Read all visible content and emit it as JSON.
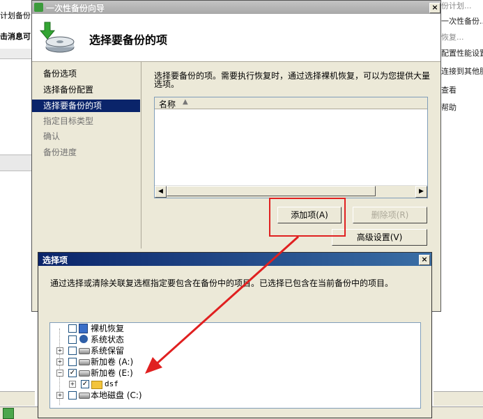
{
  "background": {
    "left_col": {
      "row1": "计划备份",
      "row2": "击消息可"
    },
    "right_actions": [
      "份计划...",
      "一次性备份...",
      "恢复...",
      "配置性能设置",
      "连接到其他服",
      "查看",
      "帮助"
    ]
  },
  "wizard": {
    "title": "一次性备份向导",
    "heading": "选择要备份的项",
    "close_label": "×",
    "nav": [
      "备份选项",
      "选择备份配置",
      "选择要备份的项",
      "指定目标类型",
      "确认",
      "备份进度"
    ],
    "nav_active_index": 2,
    "description": "选择要备份的项。需要执行恢复时，通过选择裸机恢复，可以为您提供大量选项。",
    "list": {
      "column_name": "名称",
      "sort_glyph": "▲"
    },
    "buttons": {
      "add_item": "添加项(A)",
      "remove_item": "删除项(R)",
      "advanced": "高级设置(V)"
    }
  },
  "select_dialog": {
    "title": "选择项",
    "close_label": "×",
    "description": "通过选择或清除关联复选框指定要包含在备份中的项目。已选择已包含在当前备份中的项目。",
    "tree": [
      {
        "label": "裸机恢复",
        "checked": false,
        "expander": ""
      },
      {
        "label": "系统状态",
        "checked": false,
        "expander": ""
      },
      {
        "label": "系统保留",
        "checked": false,
        "expander": "+"
      },
      {
        "label": "新加卷 (A:)",
        "checked": false,
        "expander": "+"
      },
      {
        "label": "新加卷 (E:)",
        "checked": true,
        "expander": "−"
      },
      {
        "label": "dsf",
        "checked": true,
        "expander": "+"
      },
      {
        "label": "本地磁盘 (C:)",
        "checked": false,
        "expander": "+"
      }
    ]
  },
  "colors": {
    "selected_nav": "#0a246a",
    "annotation": "#e02020",
    "dialog_title": "#0a246a"
  }
}
